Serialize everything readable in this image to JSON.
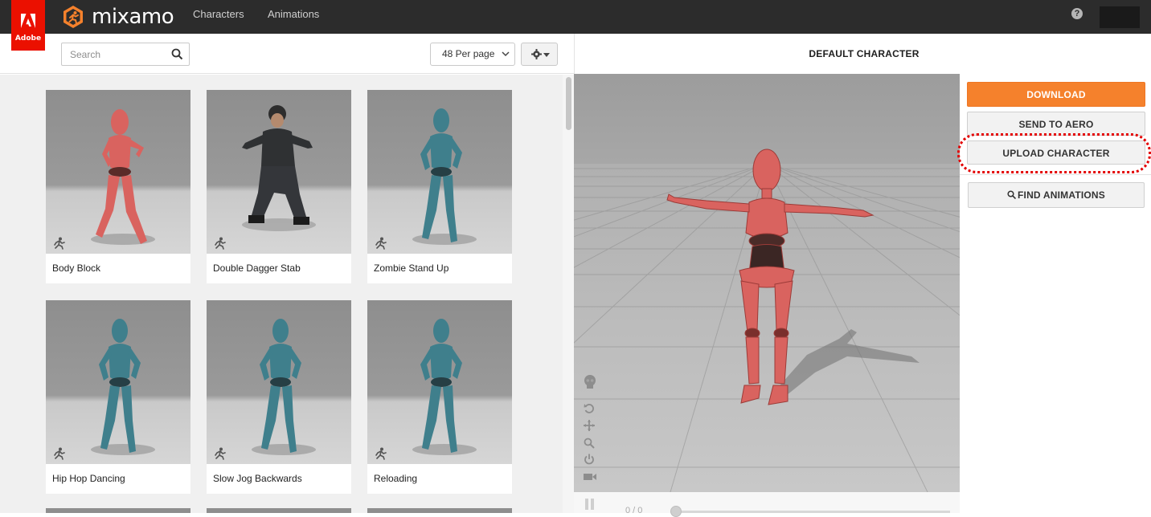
{
  "header": {
    "adobe_label": "Adobe",
    "brand": "mixamo",
    "nav": [
      "Characters",
      "Animations"
    ],
    "help": "?"
  },
  "toolbar": {
    "search_placeholder": "Search",
    "per_page": "48 Per page"
  },
  "cards": [
    {
      "label": "Body Block",
      "character": "female"
    },
    {
      "label": "Double Dagger Stab",
      "character": "soldier"
    },
    {
      "label": "Zombie Stand Up",
      "character": "robot"
    },
    {
      "label": "Hip Hop Dancing",
      "character": "robot"
    },
    {
      "label": "Slow Jog Backwards",
      "character": "robot"
    },
    {
      "label": "Reloading",
      "character": "robot"
    }
  ],
  "viewer": {
    "title": "DEFAULT CHARACTER",
    "time": "0 / 0"
  },
  "actions": {
    "download": "DOWNLOAD",
    "send_to_aero": "SEND TO AERO",
    "upload_character": "UPLOAD CHARACTER",
    "find_animations": "FIND ANIMATIONS"
  },
  "colors": {
    "accent_orange": "#f5812c",
    "adobe_red": "#eb1000",
    "highlight_red": "#e30000",
    "female_character": "#d9635f",
    "robot_character": "#3f7f8c"
  }
}
